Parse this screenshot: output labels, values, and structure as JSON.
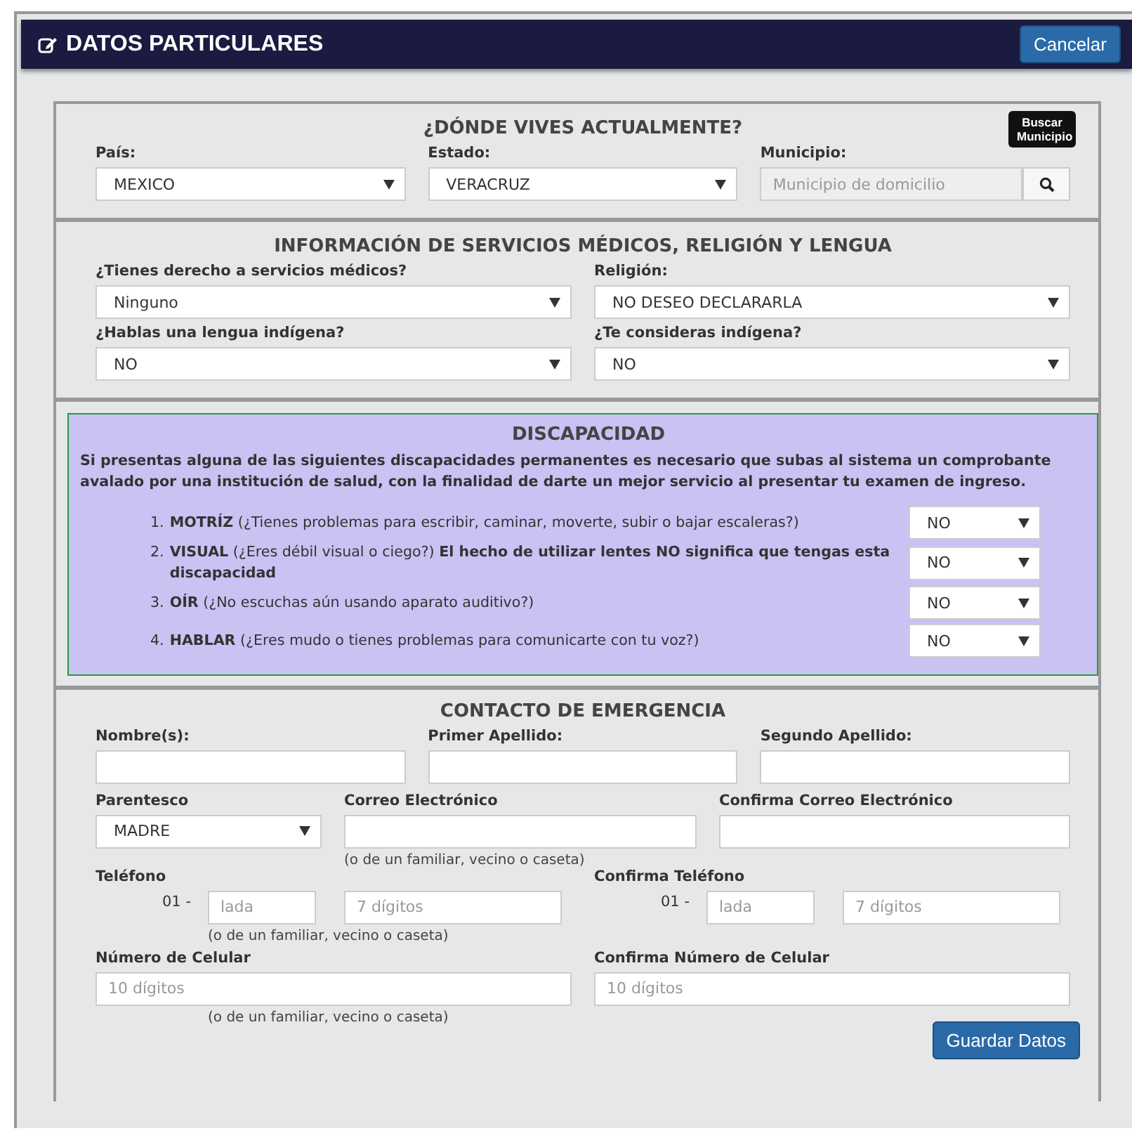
{
  "header": {
    "title": "DATOS PARTICULARES",
    "cancel_button": "Cancelar"
  },
  "location": {
    "title": "¿DÓNDE VIVES ACTUALMENTE?",
    "fields": [
      {
        "kind": "select",
        "label": "País:",
        "value": "MEXICO"
      },
      {
        "kind": "select",
        "label": "Estado:",
        "value": "VERACRUZ"
      },
      {
        "kind": "search",
        "label": "Municipio:",
        "placeholder": "Municipio de domicilio",
        "tooltip": "Buscar Municipio"
      }
    ]
  },
  "services": {
    "title": "INFORMACIÓN DE SERVICIOS MÉDICOS, RELIGIÓN Y LENGUA",
    "fields": [
      {
        "label": "¿Tienes derecho a servicios médicos?",
        "value": "Ninguno"
      },
      {
        "label": "Religión:",
        "value": "NO DESEO DECLARARLA"
      },
      {
        "label": "¿Hablas una lengua indígena?",
        "value": "NO"
      },
      {
        "label": "¿Te consideras indígena?",
        "value": "NO"
      }
    ]
  },
  "disability": {
    "title": "DISCAPACIDAD",
    "intro": "Si presentas alguna de las siguientes discapacidades permanentes es necesario que subas al sistema un comprobante avalado por una institución de salud, con la finalidad de darte un mejor servicio al presentar tu examen de ingreso.",
    "items": [
      {
        "number": "1.",
        "text": "**MOTRÍZ** (¿Tienes problemas para escribir, caminar, moverte, subir o bajar escaleras?)",
        "value": "NO"
      },
      {
        "number": "2.",
        "text": "**VISUAL** (¿Eres débil visual o ciego?) **El hecho de utilizar lentes NO significa que tengas esta discapacidad**",
        "value": "NO"
      },
      {
        "number": "3.",
        "text": "**OÍR** (¿No escuchas aún usando aparato auditivo?)",
        "value": "NO"
      },
      {
        "number": "4.",
        "text": "**HABLAR** (¿Eres mudo o tienes problemas para comunicarte con tu voz?)",
        "value": "NO"
      }
    ]
  },
  "emergency": {
    "title": "CONTACTO DE EMERGENCIA",
    "name_fields": [
      {
        "label": "Nombre(s):"
      },
      {
        "label": "Primer Apellido:"
      },
      {
        "label": "Segundo Apellido:"
      }
    ],
    "relationship": {
      "label": "Parentesco",
      "value": "MADRE"
    },
    "email": {
      "label": "Correo Electrónico",
      "hint": "(o de un familiar, vecino o caseta)"
    },
    "email_confirm": {
      "label": "Confirma Correo Electrónico"
    },
    "phone": {
      "label": "Teléfono",
      "prefix": "01 -",
      "area_placeholder": "lada",
      "number_placeholder": "7 dígitos",
      "hint": "(o de un familiar, vecino o caseta)"
    },
    "phone_confirm": {
      "label": "Confirma Teléfono",
      "prefix": "01 -",
      "area_placeholder": "lada",
      "number_placeholder": "7 dígitos"
    },
    "mobile": {
      "label": "Número de Celular",
      "placeholder": "10 dígitos",
      "hint": "(o de un familiar, vecino o caseta)"
    },
    "mobile_confirm": {
      "label": "Confirma Número de Celular",
      "placeholder": "10 dígitos"
    },
    "save_button": "Guardar Datos"
  }
}
